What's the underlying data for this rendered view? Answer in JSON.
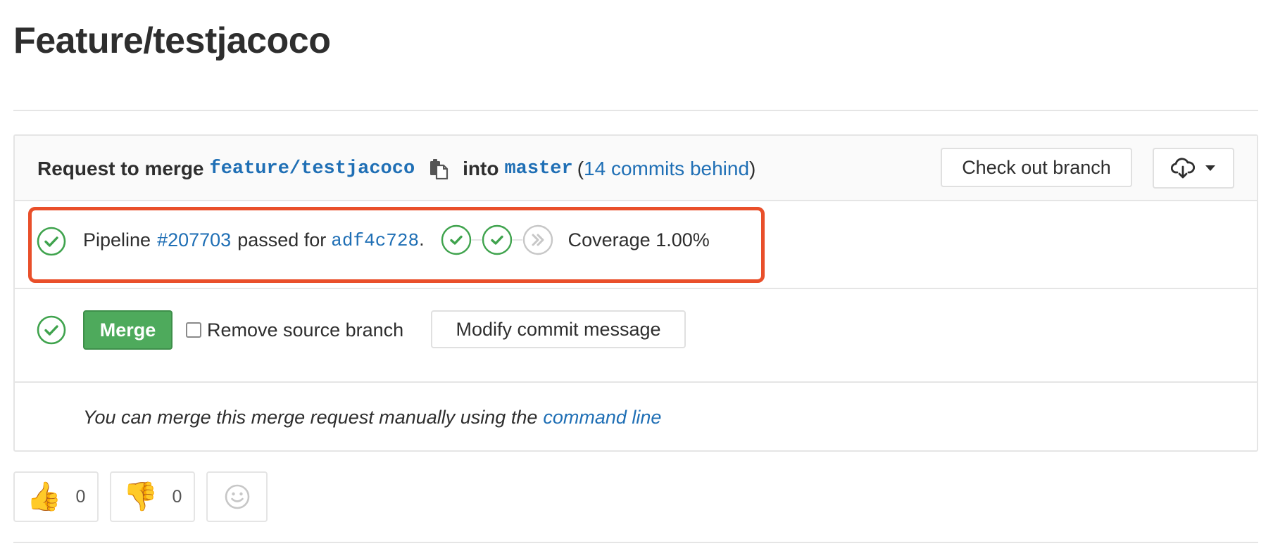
{
  "page": {
    "title": "Feature/testjacoco"
  },
  "mr_header": {
    "request_to_merge": "Request to merge",
    "source_branch": "feature/testjacoco",
    "into": "into",
    "target_branch": "master",
    "paren_open": "(",
    "commits_behind": "14 commits behind",
    "paren_close": ")",
    "checkout_label": "Check out branch",
    "download_icon": "cloud-download-icon",
    "dropdown_icon": "caret-down-icon",
    "copy_icon": "copy-to-clipboard-icon"
  },
  "pipeline": {
    "status_icon": "status-success-icon",
    "prefix": "Pipeline",
    "id": "#207703",
    "passed_for": "passed for",
    "commit": "adf4c728",
    "period": ".",
    "stages": [
      {
        "status": "success",
        "icon": "stage-success-icon"
      },
      {
        "status": "success",
        "icon": "stage-success-icon"
      },
      {
        "status": "skipped",
        "icon": "stage-skipped-icon"
      }
    ],
    "coverage": "Coverage 1.00%"
  },
  "merge": {
    "status_icon": "status-success-icon",
    "merge_label": "Merge",
    "remove_source_label": "Remove source branch",
    "remove_source_checked": false,
    "modify_commit_label": "Modify commit message"
  },
  "manual": {
    "text": "You can merge this merge request manually using the",
    "link": "command line"
  },
  "awards": {
    "thumbs_up": {
      "emoji": "👍",
      "count": "0"
    },
    "thumbs_down": {
      "emoji": "👎",
      "count": "0"
    },
    "picker_icon": "smiley-icon"
  },
  "colors": {
    "link": "#1f6fb5",
    "success": "#3fa34d",
    "merge_button": "#4eaa5c",
    "highlight": "#e94f2a",
    "border": "#e5e5e5",
    "skipped": "#c7c7c7"
  }
}
